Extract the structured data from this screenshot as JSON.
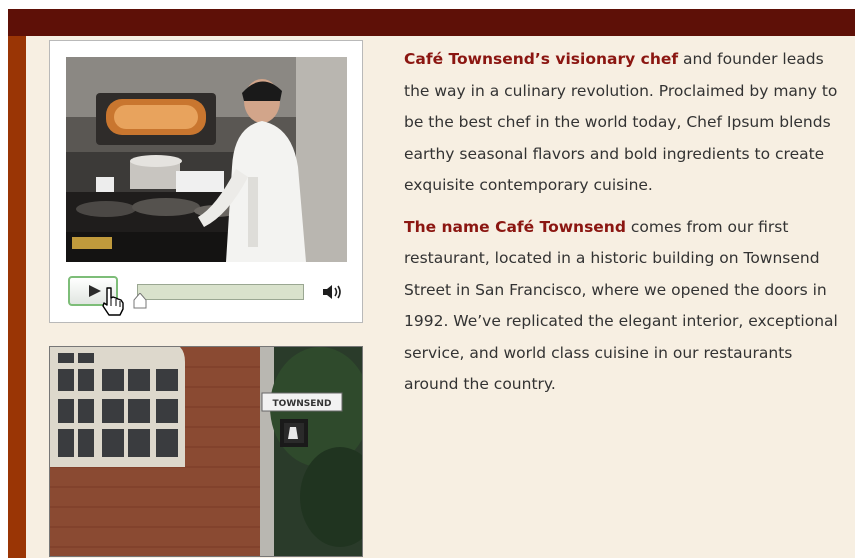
{
  "article": {
    "paragraph1": {
      "lead": "Café Townsend’s visionary chef",
      "body": "and founder leads the way in a culinary revolution. Proclaimed by many to be the best chef in the world today, Chef Ipsum blends earthy seasonal flavors and bold ingredients to create exquisite contemporary cuisine."
    },
    "paragraph2": {
      "lead": "The name Café Townsend",
      "body": "comes from our first restaurant, located in a historic building on Townsend Street in San Francisco, where we opened the doors in 1992. We’ve replicated the elegant interior, exceptional service, and world class cuisine in our restaurants around the country."
    }
  },
  "photo": {
    "street_sign": "TOWNSEND"
  },
  "video": {
    "progress": 0
  },
  "icons": {
    "play": "play-icon",
    "cursor": "hand-pointer-icon",
    "volume": "speaker-icon"
  },
  "colors": {
    "header_bar": "#5e1007",
    "side_strip": "#9a3505",
    "background": "#f7efe2",
    "accent_text": "#8b1611",
    "body_text": "#333333",
    "play_border": "#7dbd78"
  }
}
